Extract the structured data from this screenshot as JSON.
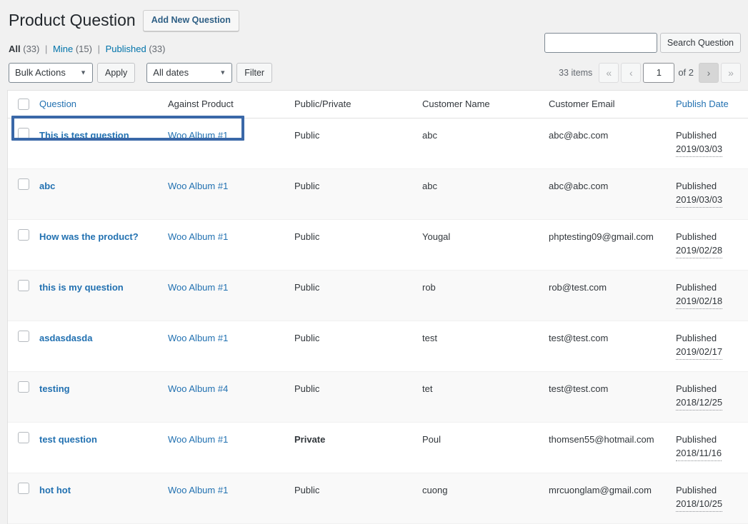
{
  "header": {
    "title": "Product Question",
    "add_new_label": "Add New Question"
  },
  "filter_links": [
    {
      "label": "All",
      "count": "(33)",
      "current": true
    },
    {
      "label": "Mine",
      "count": "(15)",
      "current": false
    },
    {
      "label": "Published",
      "count": "(33)",
      "current": false
    }
  ],
  "separator": "|",
  "search": {
    "value": "",
    "placeholder": "",
    "button_label": "Search Question"
  },
  "tablenav": {
    "bulk_actions_label": "Bulk Actions",
    "apply_label": "Apply",
    "all_dates_label": "All dates",
    "filter_label": "Filter",
    "caret_icon": "chevron-down-icon"
  },
  "pagination": {
    "items_text": "33 items",
    "first_label": "«",
    "prev_label": "‹",
    "current_page": "1",
    "total_text": "of 2",
    "next_label": "›",
    "last_label": "»",
    "next_is_active": true
  },
  "table": {
    "columns": [
      {
        "key": "cb",
        "label": "",
        "link": false
      },
      {
        "key": "question",
        "label": "Question",
        "link": true
      },
      {
        "key": "product",
        "label": "Against Product",
        "link": false
      },
      {
        "key": "visibility",
        "label": "Public/Private",
        "link": false
      },
      {
        "key": "customer_name",
        "label": "Customer Name",
        "link": false
      },
      {
        "key": "customer_email",
        "label": "Customer Email",
        "link": false
      },
      {
        "key": "publish_date",
        "label": "Publish Date",
        "link": true
      }
    ],
    "rows": [
      {
        "question": "This is test question",
        "product": "Woo Album #1",
        "visibility": "Public",
        "customer_name": "abc",
        "customer_email": "abc@abc.com",
        "status": "Published",
        "date": "2019/03/03",
        "highlighted": true
      },
      {
        "question": "abc",
        "product": "Woo Album #1",
        "visibility": "Public",
        "customer_name": "abc",
        "customer_email": "abc@abc.com",
        "status": "Published",
        "date": "2019/03/03",
        "highlighted": false
      },
      {
        "question": "How was the product?",
        "product": "Woo Album #1",
        "visibility": "Public",
        "customer_name": "Yougal",
        "customer_email": "phptesting09@gmail.com",
        "status": "Published",
        "date": "2019/02/28",
        "highlighted": false
      },
      {
        "question": "this is my question",
        "product": "Woo Album #1",
        "visibility": "Public",
        "customer_name": "rob",
        "customer_email": "rob@test.com",
        "status": "Published",
        "date": "2019/02/18",
        "highlighted": false
      },
      {
        "question": "asdasdasda",
        "product": "Woo Album #1",
        "visibility": "Public",
        "customer_name": "test",
        "customer_email": "test@test.com",
        "status": "Published",
        "date": "2019/02/17",
        "highlighted": false
      },
      {
        "question": "testing",
        "product": "Woo Album #4",
        "visibility": "Public",
        "customer_name": "tet",
        "customer_email": "test@test.com",
        "status": "Published",
        "date": "2018/12/25",
        "highlighted": false
      },
      {
        "question": "test question",
        "product": "Woo Album #1",
        "visibility": "Private",
        "customer_name": "Poul",
        "customer_email": "thomsen55@hotmail.com",
        "status": "Published",
        "date": "2018/11/16",
        "highlighted": false
      },
      {
        "question": "hot hot",
        "product": "Woo Album #1",
        "visibility": "Public",
        "customer_name": "cuong",
        "customer_email": "mrcuonglam@gmail.com",
        "status": "Published",
        "date": "2018/10/25",
        "highlighted": false
      }
    ]
  },
  "colors": {
    "link": "#2271b1",
    "page_bg": "#f1f1f1",
    "table_bg": "#ffffff",
    "alt_row_bg": "#f9f9f9",
    "highlight_border": "#3a68a8",
    "private_text": "#32373c"
  }
}
